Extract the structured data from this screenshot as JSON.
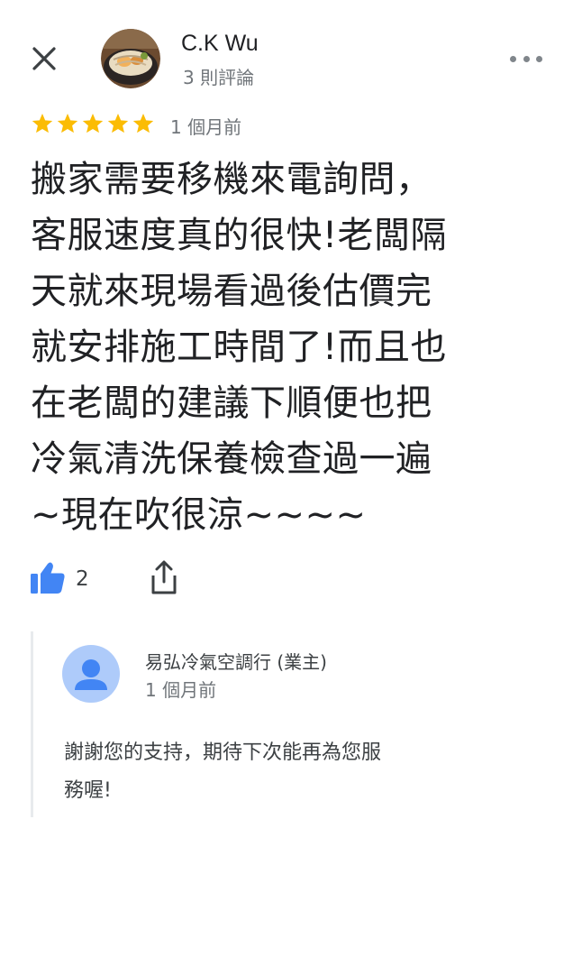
{
  "header": {
    "close_icon": "close-icon",
    "reviewer_name": "C.K Wu",
    "reviewer_review_count": "3 則評論",
    "more_icon": "more-horizontal-icon"
  },
  "review": {
    "rating": 5,
    "rating_max": 5,
    "star_color": "#fbbc04",
    "time": "1 個月前",
    "lines": [
      "搬家需要移機來電詢問，",
      "客服速度真的很快!老闆隔",
      "天就來現場看過後估價完",
      "就安排施工時間了!而且也",
      "在老闆的建議下順便也把",
      "冷氣清洗保養檢查過一遍",
      "~現在吹很涼~~~~"
    ]
  },
  "actions": {
    "like_icon": "thumbs-up-icon",
    "like_count": "2",
    "like_color": "#4285f4",
    "share_icon": "share-icon"
  },
  "owner_reply": {
    "name": "易弘冷氣空調行 (業主)",
    "time": "1 個月前",
    "lines": [
      "謝謝您的支持，期待下次能再為您服",
      "務喔!"
    ]
  }
}
